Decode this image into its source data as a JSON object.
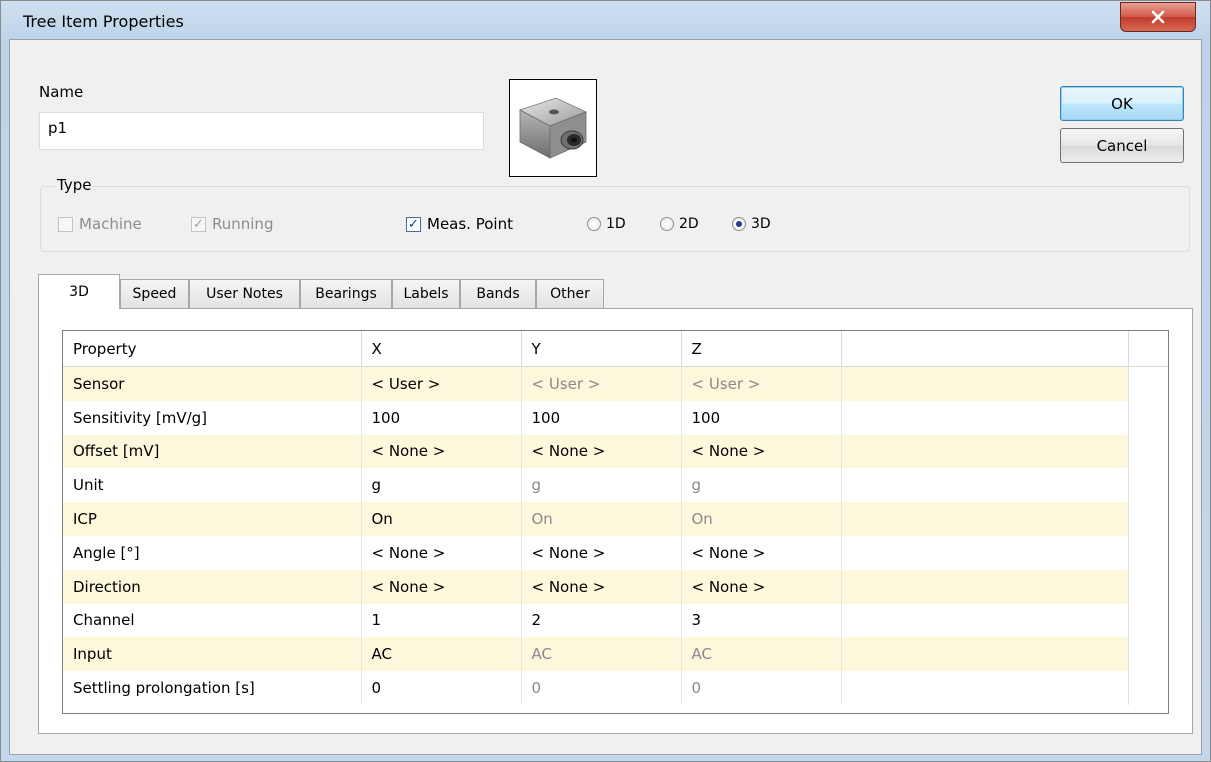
{
  "window": {
    "title": "Tree Item Properties",
    "close_label": "X"
  },
  "name_field": {
    "label": "Name",
    "value": "p1"
  },
  "picture": {
    "icon": "accelerometer-sensor-image"
  },
  "buttons": {
    "ok": "OK",
    "cancel": "Cancel"
  },
  "type_group": {
    "label": "Type",
    "machine": {
      "label": "Machine",
      "checked": false,
      "enabled": false
    },
    "running": {
      "label": "Running",
      "checked": true,
      "enabled": false
    },
    "meas_point": {
      "label": "Meas. Point",
      "checked": true,
      "enabled": true
    },
    "dims": [
      {
        "label": "1D",
        "selected": false
      },
      {
        "label": "2D",
        "selected": false
      },
      {
        "label": "3D",
        "selected": true
      }
    ]
  },
  "tabs": [
    {
      "label": "3D",
      "active": true
    },
    {
      "label": "Speed"
    },
    {
      "label": "User Notes"
    },
    {
      "label": "Bearings"
    },
    {
      "label": "Labels"
    },
    {
      "label": "Bands"
    },
    {
      "label": "Other"
    }
  ],
  "grid": {
    "columns": [
      "Property",
      "X",
      "Y",
      "Z"
    ],
    "rows": [
      {
        "property": "Sensor",
        "x": "< User >",
        "y": "< User >",
        "z": "< User >",
        "y_disabled": true,
        "z_disabled": true
      },
      {
        "property": "Sensitivity [mV/g]",
        "x": "100",
        "y": "100",
        "z": "100",
        "y_disabled": false,
        "z_disabled": false
      },
      {
        "property": "Offset [mV]",
        "x": "< None >",
        "y": "< None >",
        "z": "< None >",
        "y_disabled": false,
        "z_disabled": false
      },
      {
        "property": "Unit",
        "x": "g",
        "y": "g",
        "z": "g",
        "y_disabled": true,
        "z_disabled": true
      },
      {
        "property": "ICP",
        "x": "On",
        "y": "On",
        "z": "On",
        "y_disabled": true,
        "z_disabled": true
      },
      {
        "property": "Angle [°]",
        "x": "< None >",
        "y": "< None >",
        "z": "< None >",
        "y_disabled": false,
        "z_disabled": false
      },
      {
        "property": "Direction",
        "x": "< None >",
        "y": "< None >",
        "z": "< None >",
        "y_disabled": false,
        "z_disabled": false
      },
      {
        "property": "Channel",
        "x": "1",
        "y": "2",
        "z": "3",
        "y_disabled": false,
        "z_disabled": false
      },
      {
        "property": "Input",
        "x": "AC",
        "y": "AC",
        "z": "AC",
        "y_disabled": true,
        "z_disabled": true
      },
      {
        "property": "Settling prolongation [s]",
        "x": "0",
        "y": "0",
        "z": "0",
        "y_disabled": true,
        "z_disabled": true
      }
    ]
  },
  "colors": {
    "row_highlight": "#fdf7dc",
    "disabled_text": "#8a8a8a",
    "close_button": "#c9463a"
  }
}
